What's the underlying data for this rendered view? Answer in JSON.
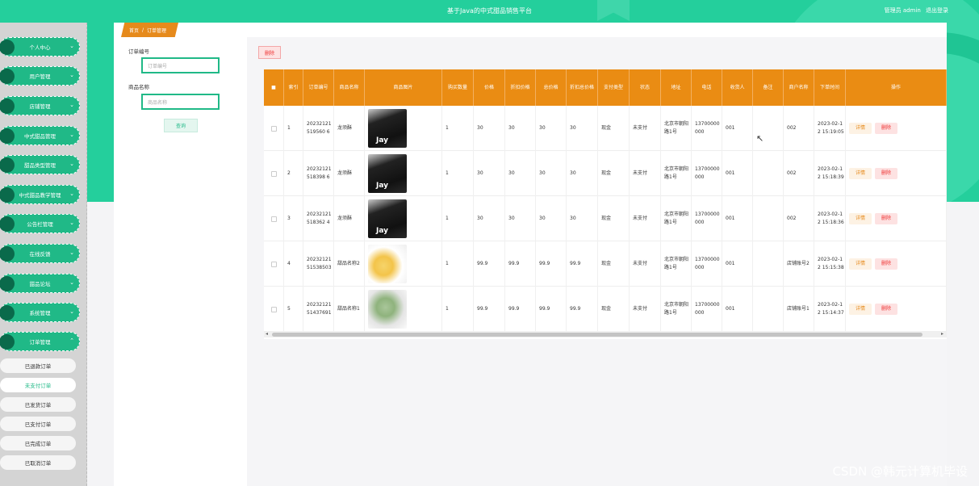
{
  "header": {
    "title": "基于Java的中式甜品销售平台",
    "user_label": "管理员 admin",
    "logout": "退出登录"
  },
  "breadcrumb": {
    "home": "首页",
    "sep": "/",
    "current": "订单管理"
  },
  "sidebar": {
    "items": [
      {
        "label": "个人中心"
      },
      {
        "label": "用户管理"
      },
      {
        "label": "店铺管理"
      },
      {
        "label": "中式甜品管理"
      },
      {
        "label": "甜品类型管理"
      },
      {
        "label": "中式甜品教学管理"
      },
      {
        "label": "公告栏管理"
      },
      {
        "label": "在线反馈"
      },
      {
        "label": "甜品论坛"
      },
      {
        "label": "系统管理"
      },
      {
        "label": "订单管理"
      }
    ],
    "sub_items": [
      {
        "label": "已退款订单"
      },
      {
        "label": "未支付订单"
      },
      {
        "label": "已发货订单"
      },
      {
        "label": "已支付订单"
      },
      {
        "label": "已完成订单"
      },
      {
        "label": "已取消订单"
      }
    ]
  },
  "search": {
    "order_no_label": "订单编号",
    "order_no_placeholder": "订单编号",
    "name_label": "商品名称",
    "name_placeholder": "商品名称",
    "query": "查询"
  },
  "toolbar": {
    "delete": "删除"
  },
  "table": {
    "columns": [
      "",
      "索引",
      "订单编号",
      "商品名称",
      "商品图片",
      "购买数量",
      "价格",
      "折扣价格",
      "总价格",
      "折扣总价格",
      "支付类型",
      "状态",
      "地址",
      "电话",
      "收货人",
      "备注",
      "商户名称",
      "下单时间",
      "操作"
    ],
    "rows": [
      {
        "idx": "1",
        "order": "20232121519560 6",
        "name": "龙须酥",
        "img": "jay",
        "qty": "1",
        "price": "30",
        "disc": "30",
        "total": "30",
        "disc_total": "30",
        "pay": "现金",
        "status": "未支付",
        "addr": "北京市朝阳路1号",
        "phone": "13700000000",
        "recv": "001",
        "note": "",
        "shop": "002",
        "time": "2023-02-12 15:19:05"
      },
      {
        "idx": "2",
        "order": "20232121518398 6",
        "name": "龙须酥",
        "img": "jay",
        "qty": "1",
        "price": "30",
        "disc": "30",
        "total": "30",
        "disc_total": "30",
        "pay": "现金",
        "status": "未支付",
        "addr": "北京市朝阳路1号",
        "phone": "13700000000",
        "recv": "001",
        "note": "",
        "shop": "002",
        "time": "2023-02-12 15:18:39"
      },
      {
        "idx": "3",
        "order": "20232121518362 4",
        "name": "龙须酥",
        "img": "jay",
        "qty": "1",
        "price": "30",
        "disc": "30",
        "total": "30",
        "disc_total": "30",
        "pay": "现金",
        "status": "未支付",
        "addr": "北京市朝阳路1号",
        "phone": "13700000000",
        "recv": "001",
        "note": "",
        "shop": "002",
        "time": "2023-02-12 15:18:36"
      },
      {
        "idx": "4",
        "order": "2023212151538503",
        "name": "甜品名称2",
        "img": "cake1",
        "qty": "1",
        "price": "99.9",
        "disc": "99.9",
        "total": "99.9",
        "disc_total": "99.9",
        "pay": "现金",
        "status": "未支付",
        "addr": "北京市朝阳路1号",
        "phone": "13700000000",
        "recv": "001",
        "note": "",
        "shop": "店铺账号2",
        "time": "2023-02-12 15:15:38"
      },
      {
        "idx": "5",
        "order": "2023212151437691",
        "name": "甜品名称1",
        "img": "cake2",
        "qty": "1",
        "price": "99.9",
        "disc": "99.9",
        "total": "99.9",
        "disc_total": "99.9",
        "pay": "现金",
        "status": "未支付",
        "addr": "北京市朝阳路1号",
        "phone": "13700000000",
        "recv": "001",
        "note": "",
        "shop": "店铺账号1",
        "time": "2023-02-12 15:14:37"
      }
    ],
    "detail_label": "详情",
    "delete_label": "删除"
  },
  "watermark": "CSDN @韩元计算机毕设"
}
